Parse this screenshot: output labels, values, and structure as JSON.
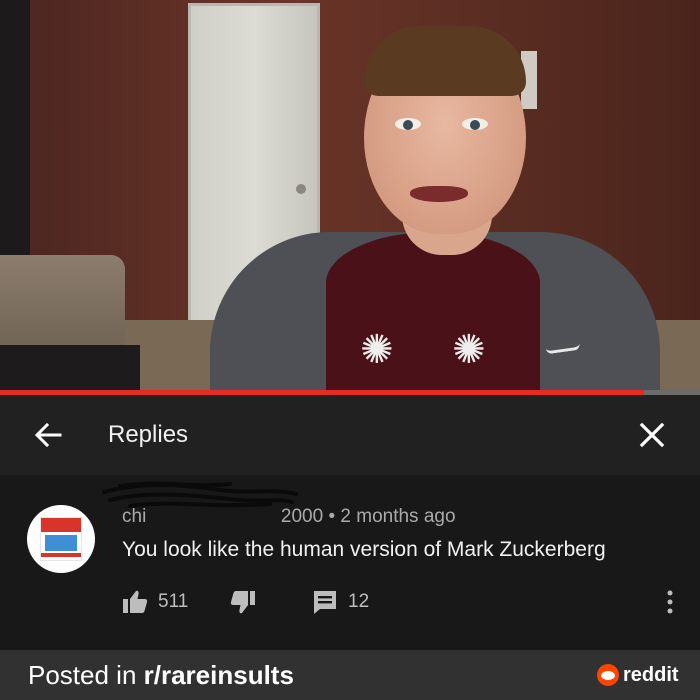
{
  "video": {
    "progress_fraction": 0.92
  },
  "header": {
    "title": "Replies",
    "back_icon": "arrow-left-icon",
    "close_icon": "close-icon"
  },
  "comment": {
    "username": "chi                                   2000",
    "separator": "•",
    "time": "2 months ago",
    "text": "You look like the human version of Mark Zuckerberg",
    "likes": "511",
    "replies": "12"
  },
  "footer": {
    "posted_prefix": "Posted in ",
    "subreddit": "r/rareinsults",
    "brand": "reddit"
  },
  "colors": {
    "progress": "#e52c24",
    "header_bg": "#212121",
    "comment_bg": "#181818",
    "footer_bg": "#313131",
    "reddit_orange": "#ff4500"
  }
}
